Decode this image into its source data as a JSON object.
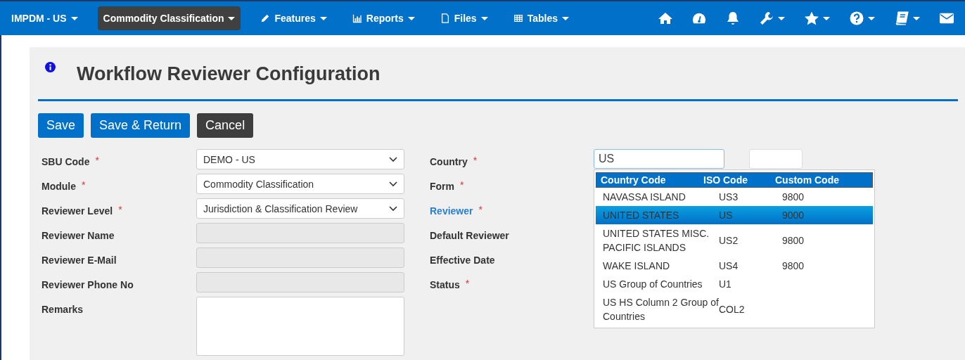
{
  "navbar": {
    "items": [
      {
        "label": "IMPDM - US",
        "selected": false
      },
      {
        "label": "Commodity Classification",
        "selected": true
      },
      {
        "label": "Features",
        "selected": false
      },
      {
        "label": "Reports",
        "selected": false
      },
      {
        "label": "Files",
        "selected": false
      },
      {
        "label": "Tables",
        "selected": false
      }
    ],
    "tools": [
      {
        "dropdown": false
      },
      {
        "dropdown": false
      },
      {
        "dropdown": false
      },
      {
        "dropdown": true
      },
      {
        "dropdown": true
      },
      {
        "dropdown": true
      },
      {
        "dropdown": true
      },
      {
        "dropdown": false
      }
    ]
  },
  "page": {
    "title": "Workflow Reviewer Configuration"
  },
  "buttons": [
    {
      "label": "Save",
      "kind": "primary"
    },
    {
      "label": "Save & Return",
      "kind": "primary"
    },
    {
      "label": "Cancel",
      "kind": "dark"
    }
  ],
  "left_fields": [
    {
      "label": "SBU Code",
      "required_mark": "*",
      "kind": "select",
      "value": "DEMO - US"
    },
    {
      "label": "Module",
      "required_mark": "*",
      "kind": "select",
      "value": "Commodity Classification"
    },
    {
      "label": "Reviewer Level",
      "required_mark": "*",
      "kind": "select",
      "value": "Jurisdiction & Classification Review"
    },
    {
      "label": "Reviewer Name",
      "kind": "readonly"
    },
    {
      "label": "Reviewer E-Mail",
      "kind": "readonly"
    },
    {
      "label": "Reviewer Phone No",
      "kind": "readonly"
    },
    {
      "label": "Remarks",
      "kind": "textarea"
    }
  ],
  "right_fields": [
    {
      "label": "Country",
      "required_mark": "*",
      "kind": "plain"
    },
    {
      "label": "Form",
      "required_mark": "*",
      "kind": "plain"
    },
    {
      "label": "Reviewer",
      "required_mark": "*",
      "kind": "link"
    },
    {
      "label": "Default Reviewer",
      "kind": "plain"
    },
    {
      "label": "Effective Date",
      "kind": "plain"
    },
    {
      "label": "Status",
      "required_mark": "*",
      "kind": "plain"
    }
  ],
  "country_input": {
    "value": "US"
  },
  "country_dropdown": {
    "columns": [
      "Country Code",
      "ISO Code",
      "Custom Code"
    ],
    "rows": [
      {
        "country": "NAVASSA ISLAND",
        "iso": "US3",
        "custom": "9800",
        "selected": false
      },
      {
        "country": "UNITED STATES",
        "iso": "US",
        "custom": "9000",
        "selected": true
      },
      {
        "country": "UNITED STATES MISC. PACIFIC ISLANDS",
        "iso": "US2",
        "custom": "9800",
        "selected": false
      },
      {
        "country": "WAKE ISLAND",
        "iso": "US4",
        "custom": "9800",
        "selected": false
      },
      {
        "country": "US Group of Countries",
        "iso": "U1",
        "selected": false
      },
      {
        "country": "US HS Column 2 Group of Countries",
        "iso": "COL2",
        "selected": false
      }
    ]
  }
}
